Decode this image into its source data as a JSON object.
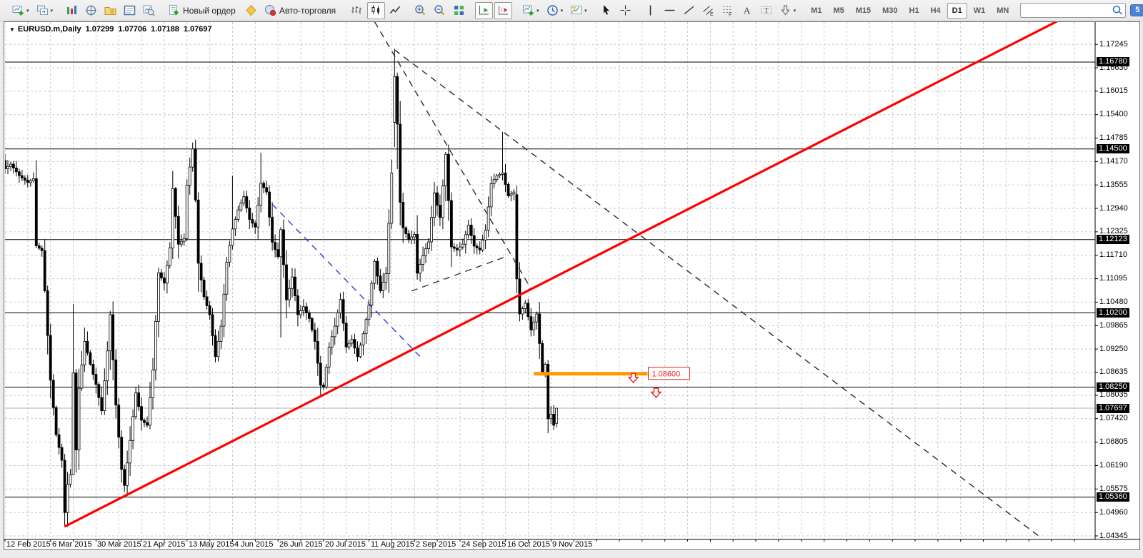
{
  "toolbar": {
    "items": [
      {
        "t": "grip"
      },
      {
        "t": "btn",
        "name": "new-chart",
        "icon": "new-chart",
        "caret": true
      },
      {
        "t": "btn",
        "name": "profiles",
        "icon": "profiles",
        "caret": true
      },
      {
        "t": "sep"
      },
      {
        "t": "btn",
        "name": "market-watch",
        "icon": "market-watch"
      },
      {
        "t": "btn",
        "name": "data-window",
        "icon": "data-window"
      },
      {
        "t": "btn",
        "name": "navigator",
        "icon": "navigator"
      },
      {
        "t": "btn",
        "name": "terminal",
        "icon": "terminal"
      },
      {
        "t": "btn",
        "name": "strategy-tester",
        "icon": "strategy-tester"
      },
      {
        "t": "sep"
      },
      {
        "t": "btn",
        "name": "new-order",
        "icon": "new-order",
        "label": "Новый ордер"
      },
      {
        "t": "btn",
        "name": "metaeditor",
        "icon": "metaeditor"
      },
      {
        "t": "btn",
        "name": "auto-trading",
        "icon": "auto-trading",
        "label": "Авто-торговля"
      },
      {
        "t": "grip"
      },
      {
        "t": "btn",
        "name": "chart-bars",
        "icon": "chart-bars"
      },
      {
        "t": "btn",
        "name": "chart-candles",
        "icon": "chart-candles",
        "active": true
      },
      {
        "t": "btn",
        "name": "chart-line",
        "icon": "chart-line"
      },
      {
        "t": "sep"
      },
      {
        "t": "btn",
        "name": "zoom-in",
        "icon": "zoom-in"
      },
      {
        "t": "btn",
        "name": "zoom-out",
        "icon": "zoom-out"
      },
      {
        "t": "btn",
        "name": "tile-windows",
        "icon": "tile-windows"
      },
      {
        "t": "sep"
      },
      {
        "t": "btn",
        "name": "auto-scroll",
        "icon": "auto-scroll",
        "active": true
      },
      {
        "t": "btn",
        "name": "chart-shift",
        "icon": "chart-shift",
        "active": true
      },
      {
        "t": "sep"
      },
      {
        "t": "btn",
        "name": "indicators",
        "icon": "indicators",
        "caret": true
      },
      {
        "t": "btn",
        "name": "periods",
        "icon": "periods",
        "caret": true
      },
      {
        "t": "btn",
        "name": "templates",
        "icon": "templates",
        "caret": true
      },
      {
        "t": "grip"
      },
      {
        "t": "btn",
        "name": "cursor",
        "icon": "cursor"
      },
      {
        "t": "btn",
        "name": "crosshair",
        "icon": "crosshair"
      },
      {
        "t": "sep"
      },
      {
        "t": "btn",
        "name": "vertical-line",
        "icon": "vertical-line"
      },
      {
        "t": "btn",
        "name": "horizontal-line",
        "icon": "horizontal-line"
      },
      {
        "t": "btn",
        "name": "trendline",
        "icon": "trendline"
      },
      {
        "t": "btn",
        "name": "equidistant-channel",
        "icon": "equidistant-channel"
      },
      {
        "t": "btn",
        "name": "fibonacci",
        "icon": "fibonacci"
      },
      {
        "t": "btn",
        "name": "text",
        "icon": "text"
      },
      {
        "t": "btn",
        "name": "text-label",
        "icon": "text-label"
      },
      {
        "t": "btn",
        "name": "arrows",
        "icon": "arrows",
        "caret": true
      },
      {
        "t": "grip"
      },
      {
        "t": "tf"
      },
      {
        "t": "search"
      },
      {
        "t": "badge"
      }
    ],
    "timeframes": {
      "items": [
        "M1",
        "M5",
        "M15",
        "M30",
        "H1",
        "H4",
        "D1",
        "W1",
        "MN"
      ],
      "selected": "D1"
    },
    "search": {
      "placeholder": ""
    },
    "chat_badge": "5"
  },
  "chart_header": {
    "symbol_period": "EURUSD.m,Daily",
    "open": "1.07299",
    "high": "1.07706",
    "low": "1.07188",
    "close": "1.07697"
  },
  "chart_data": {
    "type": "candlestick",
    "symbol": "EURUSD.m",
    "timeframe": "Daily",
    "last_bar": {
      "open": 1.07299,
      "high": 1.07706,
      "low": 1.07188,
      "close": 1.07697
    },
    "y_axis": {
      "ticks": [
        "1.17245",
        "1.16630",
        "1.16015",
        "1.15400",
        "1.14785",
        "1.14170",
        "1.13555",
        "1.12940",
        "1.12325",
        "1.11710",
        "1.11095",
        "1.10480",
        "1.09865",
        "1.09250",
        "1.08635",
        "1.08035",
        "1.07420",
        "1.06805",
        "1.06190",
        "1.05575",
        "1.04960",
        "1.04345"
      ],
      "highlighted": [
        "1.16780",
        "1.14500",
        "1.12123",
        "1.10200",
        "1.08250",
        "1.07697",
        "1.05360"
      ]
    },
    "x_axis": {
      "labels": [
        "12 Feb 2015",
        "6 Mar 2015",
        "30 Mar 2015",
        "21 Apr 2015",
        "13 May 2015",
        "4 Jun 2015",
        "26 Jun 2015",
        "20 Jul 2015",
        "11 Aug 2015",
        "2 Sep 2015",
        "24 Sep 2015",
        "16 Oct 2015",
        "9 Nov 2015"
      ],
      "bars_per_label": 16
    },
    "levels": [
      1.1678,
      1.145,
      1.12123,
      1.102,
      1.0825,
      1.0536
    ],
    "current_price": 1.07697,
    "candles": {
      "count": 195,
      "waypoints": [
        [
          0,
          1.1398
        ],
        [
          2,
          1.141
        ],
        [
          5,
          1.138
        ],
        [
          8,
          1.1362
        ],
        [
          10,
          1.1372
        ],
        [
          11,
          1.1196
        ],
        [
          13,
          1.1183
        ],
        [
          14,
          1.1078
        ],
        [
          16,
          1.0843
        ],
        [
          18,
          1.07
        ],
        [
          20,
          1.0633
        ],
        [
          21,
          1.0496
        ],
        [
          22,
          1.057
        ],
        [
          23,
          1.0595
        ],
        [
          24,
          1.0862
        ],
        [
          25,
          1.066
        ],
        [
          26,
          1.0822
        ],
        [
          28,
          1.0945
        ],
        [
          30,
          1.0885
        ],
        [
          32,
          1.0832
        ],
        [
          34,
          1.0763
        ],
        [
          36,
          1.092
        ],
        [
          37,
          1.1015
        ],
        [
          39,
          1.0778
        ],
        [
          41,
          1.0609
        ],
        [
          42,
          1.0567
        ],
        [
          44,
          1.0685
        ],
        [
          46,
          1.081
        ],
        [
          48,
          1.0738
        ],
        [
          50,
          1.0725
        ],
        [
          52,
          1.087
        ],
        [
          54,
          1.1125
        ],
        [
          56,
          1.1098
        ],
        [
          58,
          1.119
        ],
        [
          59,
          1.1346
        ],
        [
          61,
          1.12
        ],
        [
          63,
          1.1215
        ],
        [
          64,
          1.1355
        ],
        [
          66,
          1.145
        ],
        [
          67,
          1.1316
        ],
        [
          68,
          1.115
        ],
        [
          70,
          1.1062
        ],
        [
          72,
          1.1015
        ],
        [
          74,
          1.0905
        ],
        [
          76,
          1.0985
        ],
        [
          78,
          1.1153
        ],
        [
          80,
          1.124
        ],
        [
          82,
          1.129
        ],
        [
          84,
          1.1325
        ],
        [
          86,
          1.1265
        ],
        [
          88,
          1.1245
        ],
        [
          90,
          1.136
        ],
        [
          92,
          1.1337
        ],
        [
          94,
          1.1205
        ],
        [
          96,
          1.1167
        ],
        [
          97,
          1.1238
        ],
        [
          99,
          1.1054
        ],
        [
          101,
          1.1114
        ],
        [
          103,
          1.1015
        ],
        [
          105,
          1.1036
        ],
        [
          107,
          1.1005
        ],
        [
          109,
          1.0945
        ],
        [
          111,
          1.083
        ],
        [
          112,
          1.0825
        ],
        [
          114,
          1.093
        ],
        [
          116,
          1.0985
        ],
        [
          118,
          1.1055
        ],
        [
          120,
          1.093
        ],
        [
          122,
          1.095
        ],
        [
          124,
          1.0905
        ],
        [
          126,
          1.0965
        ],
        [
          128,
          1.104
        ],
        [
          130,
          1.1155
        ],
        [
          132,
          1.1078
        ],
        [
          134,
          1.1123
        ],
        [
          136,
          1.1387
        ],
        [
          139,
          1.131
        ],
        [
          140,
          1.1243
        ],
        [
          142,
          1.1212
        ],
        [
          144,
          1.1226
        ],
        [
          145,
          1.1124
        ],
        [
          147,
          1.117
        ],
        [
          149,
          1.1206
        ],
        [
          151,
          1.1335
        ],
        [
          153,
          1.127
        ],
        [
          155,
          1.1436
        ],
        [
          157,
          1.1193
        ],
        [
          159,
          1.1185
        ],
        [
          161,
          1.12
        ],
        [
          163,
          1.125
        ],
        [
          165,
          1.1195
        ],
        [
          167,
          1.1185
        ],
        [
          169,
          1.1237
        ],
        [
          171,
          1.1359
        ],
        [
          173,
          1.138
        ],
        [
          175,
          1.1387
        ],
        [
          177,
          1.1327
        ],
        [
          179,
          1.1337
        ],
        [
          180,
          1.1109
        ],
        [
          181,
          1.1017
        ],
        [
          183,
          1.1045
        ],
        [
          185,
          1.0975
        ],
        [
          187,
          1.1017
        ],
        [
          189,
          1.0862
        ],
        [
          190,
          1.0885
        ],
        [
          191,
          1.0742
        ],
        [
          192,
          1.0754
        ],
        [
          193,
          1.0725
        ],
        [
          194,
          1.077
        ]
      ],
      "overrides": {
        "0": {
          "o": 1.142
        },
        "21": {
          "l": 1.0458
        },
        "24": {
          "h": 1.1043,
          "l": 1.0595
        },
        "59": {
          "h": 1.1392
        },
        "66": {
          "h": 1.1467
        },
        "80": {
          "h": 1.138
        },
        "90": {
          "h": 1.144
        },
        "97": {
          "l": 1.0955
        },
        "137": {
          "o": 1.152,
          "h": 1.1713,
          "l": 1.1455,
          "c": 1.164
        },
        "138": {
          "o": 1.164,
          "h": 1.165,
          "l": 1.1397,
          "c": 1.1515
        },
        "155": {
          "h": 1.1442
        },
        "175": {
          "h": 1.1495
        },
        "180": {
          "o": 1.133,
          "h": 1.1353,
          "l": 1.1072,
          "c": 1.1109
        },
        "191": {
          "o": 1.0885,
          "h": 1.0896,
          "l": 1.0704,
          "c": 1.0742
        },
        "194": {
          "o": 1.07299,
          "h": 1.07706,
          "l": 1.07188,
          "c": 1.07697
        }
      }
    },
    "trendlines": [
      {
        "name": "bull-trendline",
        "color": "#ff0000",
        "style": "solid",
        "width": 3.2,
        "from": [
          21,
          1.0459
        ],
        "to": [
          370,
          1.1785
        ]
      },
      {
        "name": "wedge-upper-steep",
        "color": "#2a2a2a",
        "style": "dashed",
        "width": 1.4,
        "from": [
          130,
          1.1784
        ],
        "to": [
          185,
          1.1083
        ]
      },
      {
        "name": "long-resistance",
        "color": "#2a2a2a",
        "style": "dashed",
        "width": 1.4,
        "from": [
          137,
          1.171
        ],
        "to": [
          364,
          1.0432
        ]
      },
      {
        "name": "triangle-lower",
        "color": "#2a2a2a",
        "style": "dashed",
        "width": 1.3,
        "from": [
          143,
          1.1077
        ],
        "to": [
          176,
          1.1167
        ]
      },
      {
        "name": "blue-channel",
        "color": "#2b2bc8",
        "style": "dashed",
        "width": 1.3,
        "from": [
          94,
          1.1305
        ],
        "to": [
          146,
          1.0905
        ]
      }
    ],
    "orange_level": {
      "price": 1.086,
      "from_index": 186,
      "to_index": 226,
      "label": "1.08600",
      "color": "#ff9900",
      "label_color": "#e82020"
    },
    "arrows": [
      {
        "index": 221,
        "price": 1.0849,
        "direction": "down",
        "color": "#e82020"
      },
      {
        "index": 229,
        "price": 1.081,
        "direction": "down",
        "color": "#e82020"
      }
    ],
    "grid": true,
    "background": "#ffffff"
  }
}
